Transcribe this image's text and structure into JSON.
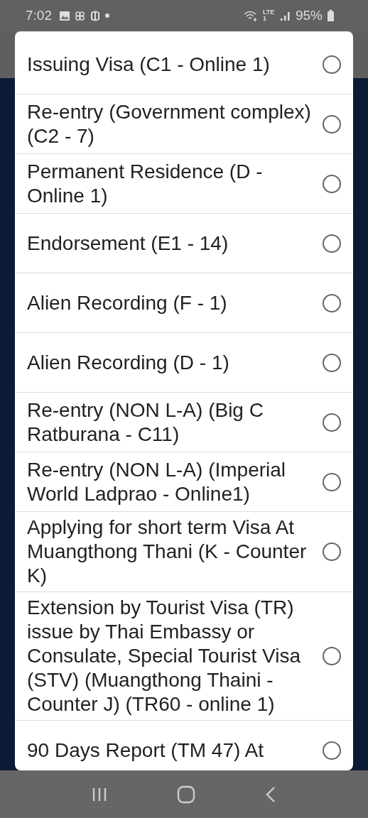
{
  "status_bar": {
    "time": "7:02",
    "battery": "95%",
    "network": "LTE1"
  },
  "options": [
    {
      "label": "Issuing Visa (C1 - Online 1)",
      "selected": false
    },
    {
      "label": "Re-entry (Government complex) (C2 - 7)",
      "selected": false
    },
    {
      "label": "Permanent Residence (D - Online 1)",
      "selected": false
    },
    {
      "label": "Endorsement (E1 - 14)",
      "selected": false
    },
    {
      "label": "Alien Recording (F - 1)",
      "selected": false
    },
    {
      "label": "Alien Recording (D - 1)",
      "selected": false
    },
    {
      "label": "Re-entry (NON L-A) (Big C Ratburana - C11)",
      "selected": false
    },
    {
      "label": "Re-entry (NON L-A) (Imperial World Ladprao - Online1)",
      "selected": false
    },
    {
      "label": "Applying for short term Visa At Muangthong Thani (K - Counter K)",
      "selected": false
    },
    {
      "label": "Extension by Tourist Visa (TR) issue by Thai Embassy or Consulate, Special Tourist Visa (STV) (Muangthong Thaini - Counter J) (TR60 - online 1)",
      "selected": false
    },
    {
      "label": "90 Days Report (TM 47) At",
      "selected": false
    }
  ]
}
